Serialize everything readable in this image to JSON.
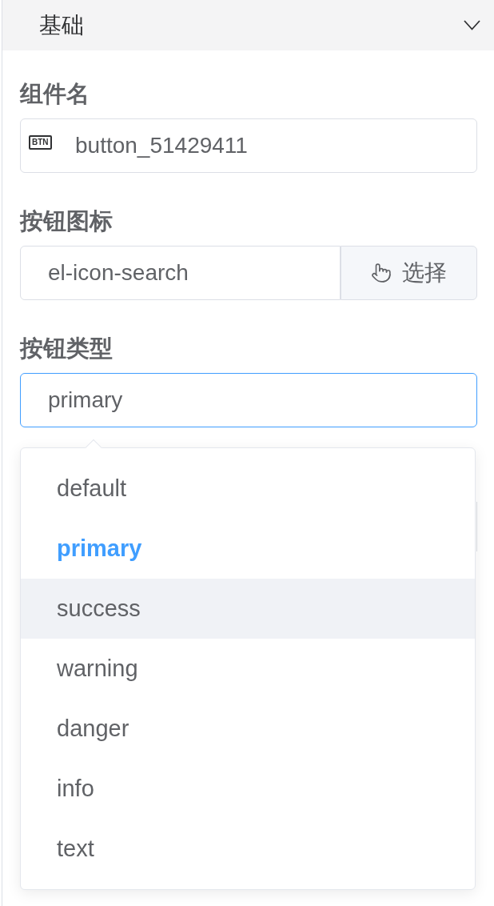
{
  "panel": {
    "title": "基础",
    "expanded": true
  },
  "fields": [
    {
      "kind": "text",
      "label": "组件名",
      "tag": "BTN",
      "value": "button_51429411",
      "focused": false
    },
    {
      "kind": "append",
      "label": "按钮图标",
      "value": "el-icon-search",
      "button": "选择",
      "focused": false
    },
    {
      "kind": "select",
      "label": "按钮类型",
      "value": "primary",
      "focused": true,
      "options": [
        {
          "label": "default",
          "selected": false,
          "hovered": false
        },
        {
          "label": "primary",
          "selected": true,
          "hovered": false
        },
        {
          "label": "success",
          "selected": false,
          "hovered": true
        },
        {
          "label": "warning",
          "selected": false,
          "hovered": false
        },
        {
          "label": "danger",
          "selected": false,
          "hovered": false
        },
        {
          "label": "info",
          "selected": false,
          "hovered": false
        },
        {
          "label": "text",
          "selected": false,
          "hovered": false
        }
      ]
    }
  ]
}
